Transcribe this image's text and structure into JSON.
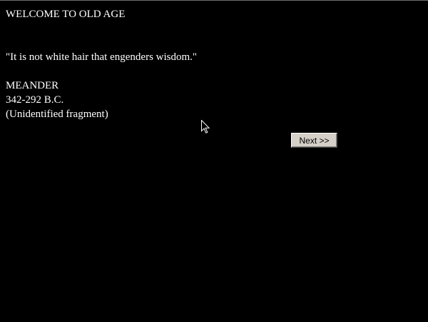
{
  "page": {
    "title": "WELCOME TO OLD AGE",
    "quote": "\"It is not white hair that engenders wisdom.\"",
    "author": "MEANDER",
    "dates": "342-292 B.C.",
    "source": "(Unidentified fragment)"
  },
  "navigation": {
    "next_label": "Next >>"
  },
  "cursor": {
    "icon": "mouse-pointer-icon"
  },
  "colors": {
    "background": "#000000",
    "text": "#ffffff",
    "button_face": "#d4d0c8"
  }
}
